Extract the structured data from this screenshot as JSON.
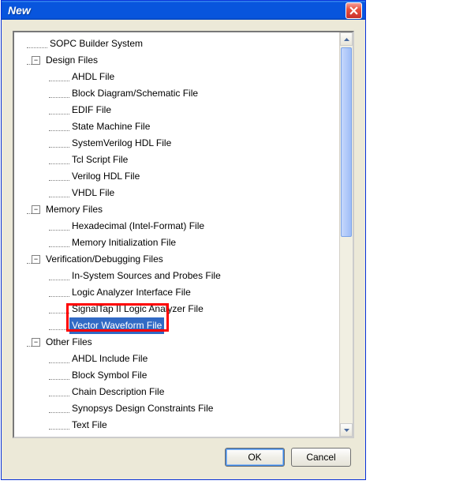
{
  "window": {
    "title": "New"
  },
  "tree": {
    "topLeaf": "SOPC Builder System",
    "categories": [
      {
        "label": "Design Files",
        "expanded": true,
        "children": [
          "AHDL File",
          "Block Diagram/Schematic File",
          "EDIF File",
          "State Machine File",
          "SystemVerilog HDL File",
          "Tcl Script File",
          "Verilog HDL File",
          "VHDL File"
        ]
      },
      {
        "label": "Memory Files",
        "expanded": true,
        "children": [
          "Hexadecimal (Intel-Format) File",
          "Memory Initialization File"
        ]
      },
      {
        "label": "Verification/Debugging Files",
        "expanded": true,
        "children": [
          "In-System Sources and Probes File",
          "Logic Analyzer Interface File",
          "SignalTap II Logic Analyzer File",
          "Vector Waveform File"
        ]
      },
      {
        "label": "Other Files",
        "expanded": true,
        "children": [
          "AHDL Include File",
          "Block Symbol File",
          "Chain Description File",
          "Synopsys Design Constraints File",
          "Text File"
        ]
      }
    ],
    "selected": "Vector Waveform File"
  },
  "buttons": {
    "ok": "OK",
    "cancel": "Cancel"
  },
  "expander": {
    "minus": "−",
    "plus": "+"
  }
}
